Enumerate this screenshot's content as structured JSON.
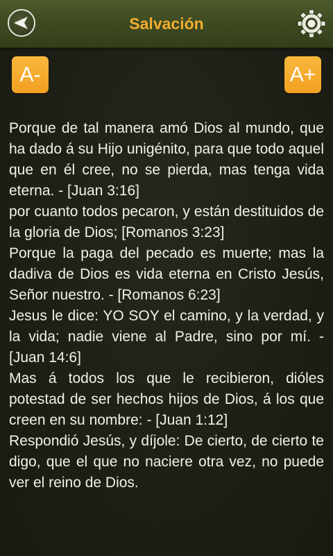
{
  "nav": {
    "title": "Salvación",
    "back_icon": "back-arrow-icon",
    "settings_icon": "gear-icon"
  },
  "font_controls": {
    "decrease_label": "A-",
    "increase_label": "A+"
  },
  "verses": [
    "Porque de tal manera amó Dios al mundo, que ha dado á su Hijo unigénito, para que todo aquel que en él cree, no se pierda, mas tenga vida eterna. - [Juan 3:16]",
    "por cuanto todos pecaron, y están destituidos de la gloria de Dios; [Romanos 3:23]",
    "Porque la paga del pecado es muerte; mas la dadiva de Dios es vida eterna en Cristo Jesús, Señor nuestro. - [Romanos 6:23]",
    "Jesus le dice: YO SOY el camino, y la verdad, y la vida; nadie viene al Padre, sino por mí. - [Juan 14:6]",
    "Mas á todos los que le recibieron, dióles potestad de ser hechos hijos de Dios, á los que creen en su nombre: - [Juan 1:12]",
    "Respondió Jesús, y díjole: De cierto, de cierto te digo, que el que no naciere otra vez, no puede ver el reino de Dios."
  ],
  "colors": {
    "accent": "#f2ad2f",
    "button": "#f6aa2c",
    "nav_bar": "#3d4a21",
    "background": "#1d1f17",
    "text": "#f1f1ea"
  }
}
